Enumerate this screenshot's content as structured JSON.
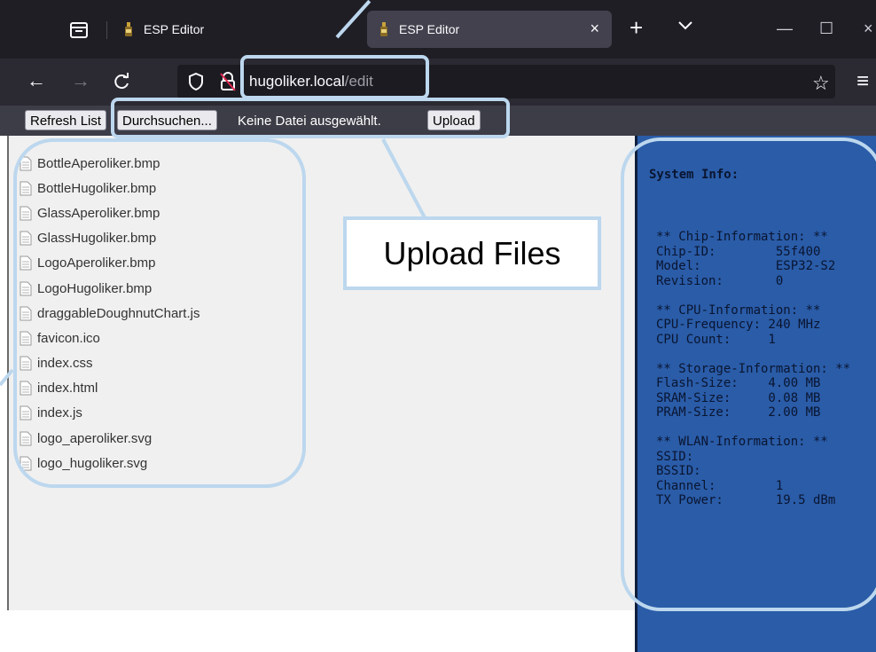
{
  "browser": {
    "tabs": [
      {
        "title": "ESP Editor",
        "active": false
      },
      {
        "title": "ESP Editor",
        "active": true
      }
    ],
    "close_symbol": "×",
    "new_tab_symbol": "+",
    "tabs_menu_symbol": "chevron-down",
    "window_controls": {
      "minimize": "—",
      "maximize": "☐",
      "close": "×"
    },
    "nav": {
      "back": "←",
      "forward": "→",
      "reload": "C"
    },
    "url": {
      "host": "hugoliker.local",
      "path": "/edit"
    },
    "star_symbol": "☆",
    "menu_symbol": "≡"
  },
  "toolbar": {
    "refresh_label": "Refresh List",
    "browse_label": "Durchsuchen...",
    "no_file_label": "Keine Datei ausgewählt.",
    "upload_label": "Upload"
  },
  "files": [
    "BottleAperoliker.bmp",
    "BottleHugoliker.bmp",
    "GlassAperoliker.bmp",
    "GlassHugoliker.bmp",
    "LogoAperoliker.bmp",
    "LogoHugoliker.bmp",
    "draggableDoughnutChart.js",
    "favicon.ico",
    "index.css",
    "index.html",
    "index.js",
    "logo_aperoliker.svg",
    "logo_hugoliker.svg"
  ],
  "system_info": {
    "title": "System Info:",
    "text": "** Chip-Information: **\nChip-ID:        55f400\nModel:          ESP32-S2\nRevision:       0\n\n** CPU-Information: **\nCPU-Frequency: 240 MHz\nCPU Count:     1\n\n** Storage-Information: **\nFlash-Size:    4.00 MB\nSRAM-Size:     0.08 MB\nPRAM-Size:     2.00 MB\n\n** WLAN-Information: **\nSSID:\nBSSID:\nChannel:        1\nTX Power:       19.5 dBm"
  },
  "annotation": {
    "upload_callout": "Upload Files",
    "color": "#bcd7ee"
  },
  "colors": {
    "tabbar": "#1f1e25",
    "navbar": "#2b2a33",
    "toolbar": "#3d3d47",
    "file_area": "#f0f0f0",
    "system_info_bg": "#2a5ca8"
  }
}
